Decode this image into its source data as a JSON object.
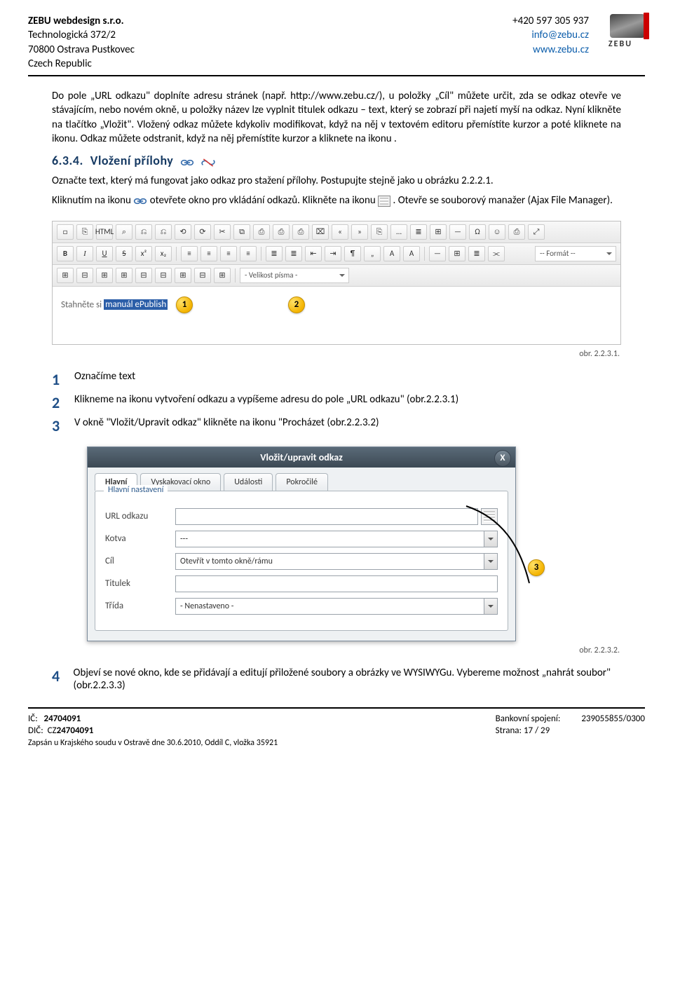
{
  "header": {
    "company": "ZEBU webdesign s.r.o.",
    "addr1": "Technologická 372/2",
    "addr2": "70800 Ostrava Pustkovec",
    "addr3": "Czech Republic",
    "phone": "+420 597 305 937",
    "email": "info@zebu.cz",
    "web": "www.zebu.cz",
    "logo_text": "ZEBU"
  },
  "body": {
    "p1": "Do pole „URL odkazu\" doplníte adresu stránek (např. http://www.zebu.cz/), u položky „Cíl\" můžete určit, zda se odkaz otevře ve stávajícím, nebo novém okně, u položky název lze vyplnit titulek odkazu – text, který se zobrazí při najetí myší na odkaz. Nyní klikněte na tlačítko „Vložit\". Vložený odkaz můžete kdykoliv modifikovat, když na něj v textovém editoru přemístíte kurzor a poté kliknete na ikonu. Odkaz můžete odstranit, když na něj přemístíte kurzor a kliknete na ikonu .",
    "section_num": "6.3.4.",
    "section_title": "Vložení přílohy",
    "p2": "Označte text, který má fungovat jako odkaz pro stažení přílohy. Postupujte stejně jako u obrázku 2.2.2.1.",
    "p3a": "Kliknutím na ikonu",
    "p3b": "otevřete okno pro vkládání odkazů. Klikněte na ikonu",
    "p3c": ". Otevře se souborový manažer (Ajax File Manager).",
    "caption1": "obr. 2.2.3.1.",
    "steps": [
      "Označíme text",
      "Klikneme na ikonu vytvoření odkazu a vypíšeme adresu do pole „URL odkazu\" (obr.2.2.3.1)",
      "V okně \"Vložit/Upravit odkaz\" klikněte na ikonu \"Procházet (obr.2.2.3.2)"
    ],
    "caption2": "obr. 2.2.3.2.",
    "step4": "Objeví se nové okno, kde se přidávají a editují přiložené soubory a obrázky ve WYSIWYGu. Vybereme možnost „nahrát soubor\" (obr.2.2.3.3)"
  },
  "editor": {
    "row1": [
      "□",
      "⎘",
      "HTML",
      "⌕",
      "⎌",
      "⎌",
      "⟲",
      "⟳",
      "✂",
      "⧉",
      "⎙",
      "⎙",
      "⎙",
      "⌧",
      "«",
      "»",
      "⎘",
      "…",
      "≣",
      "⊞",
      "—",
      "Ω",
      "☺",
      "⎙",
      "⤢"
    ],
    "row2_buttons": [
      "B",
      "I",
      "U",
      "S",
      "x²",
      "x₂"
    ],
    "row2_align": [
      "≡",
      "≡",
      "≡",
      "≡"
    ],
    "row2_list": [
      "≣",
      "≣",
      "⇤",
      "⇥",
      "¶",
      "„",
      "A",
      "A"
    ],
    "row2_misc": [
      "—",
      "⊞",
      "≣",
      "⫘"
    ],
    "format_sel": "-- Formát --",
    "row3_buttons": [
      "⊞",
      "⊟",
      "⊞",
      "⊞",
      "⊟",
      "⊟",
      "⊞",
      "⊟",
      "⊞"
    ],
    "fontsize_sel": "- Velikost písma -",
    "body_pre": "Stahněte si ",
    "body_sel": "manuál ePublish",
    "callout1": "1",
    "callout2": "2"
  },
  "dialog": {
    "title": "Vložit/upravit odkaz",
    "close": "X",
    "tabs": [
      "Hlavní",
      "Vyskakovací okno",
      "Události",
      "Pokročilé"
    ],
    "group": "Hlavní nastavení",
    "url_label": "URL odkazu",
    "url_value": "",
    "kotva_label": "Kotva",
    "kotva_value": "---",
    "cil_label": "Cíl",
    "cil_value": "Otevřít v tomto okně/rámu",
    "titulek_label": "Titulek",
    "titulek_value": "",
    "trida_label": "Třída",
    "trida_value": "- Nenastaveno -",
    "callout3": "3"
  },
  "footer": {
    "ic_label": "IČ:",
    "ic": "24704091",
    "dic_label": "DIČ:",
    "dic": "CZ24704091",
    "reg": "Zapsán u Krajského soudu v Ostravě dne 30.6.2010, Oddíl C, vložka 35921",
    "bank_label": "Bankovní spojení:",
    "bank": "239055855/0300",
    "page_label": "Strana:",
    "page": "17 / 29"
  }
}
